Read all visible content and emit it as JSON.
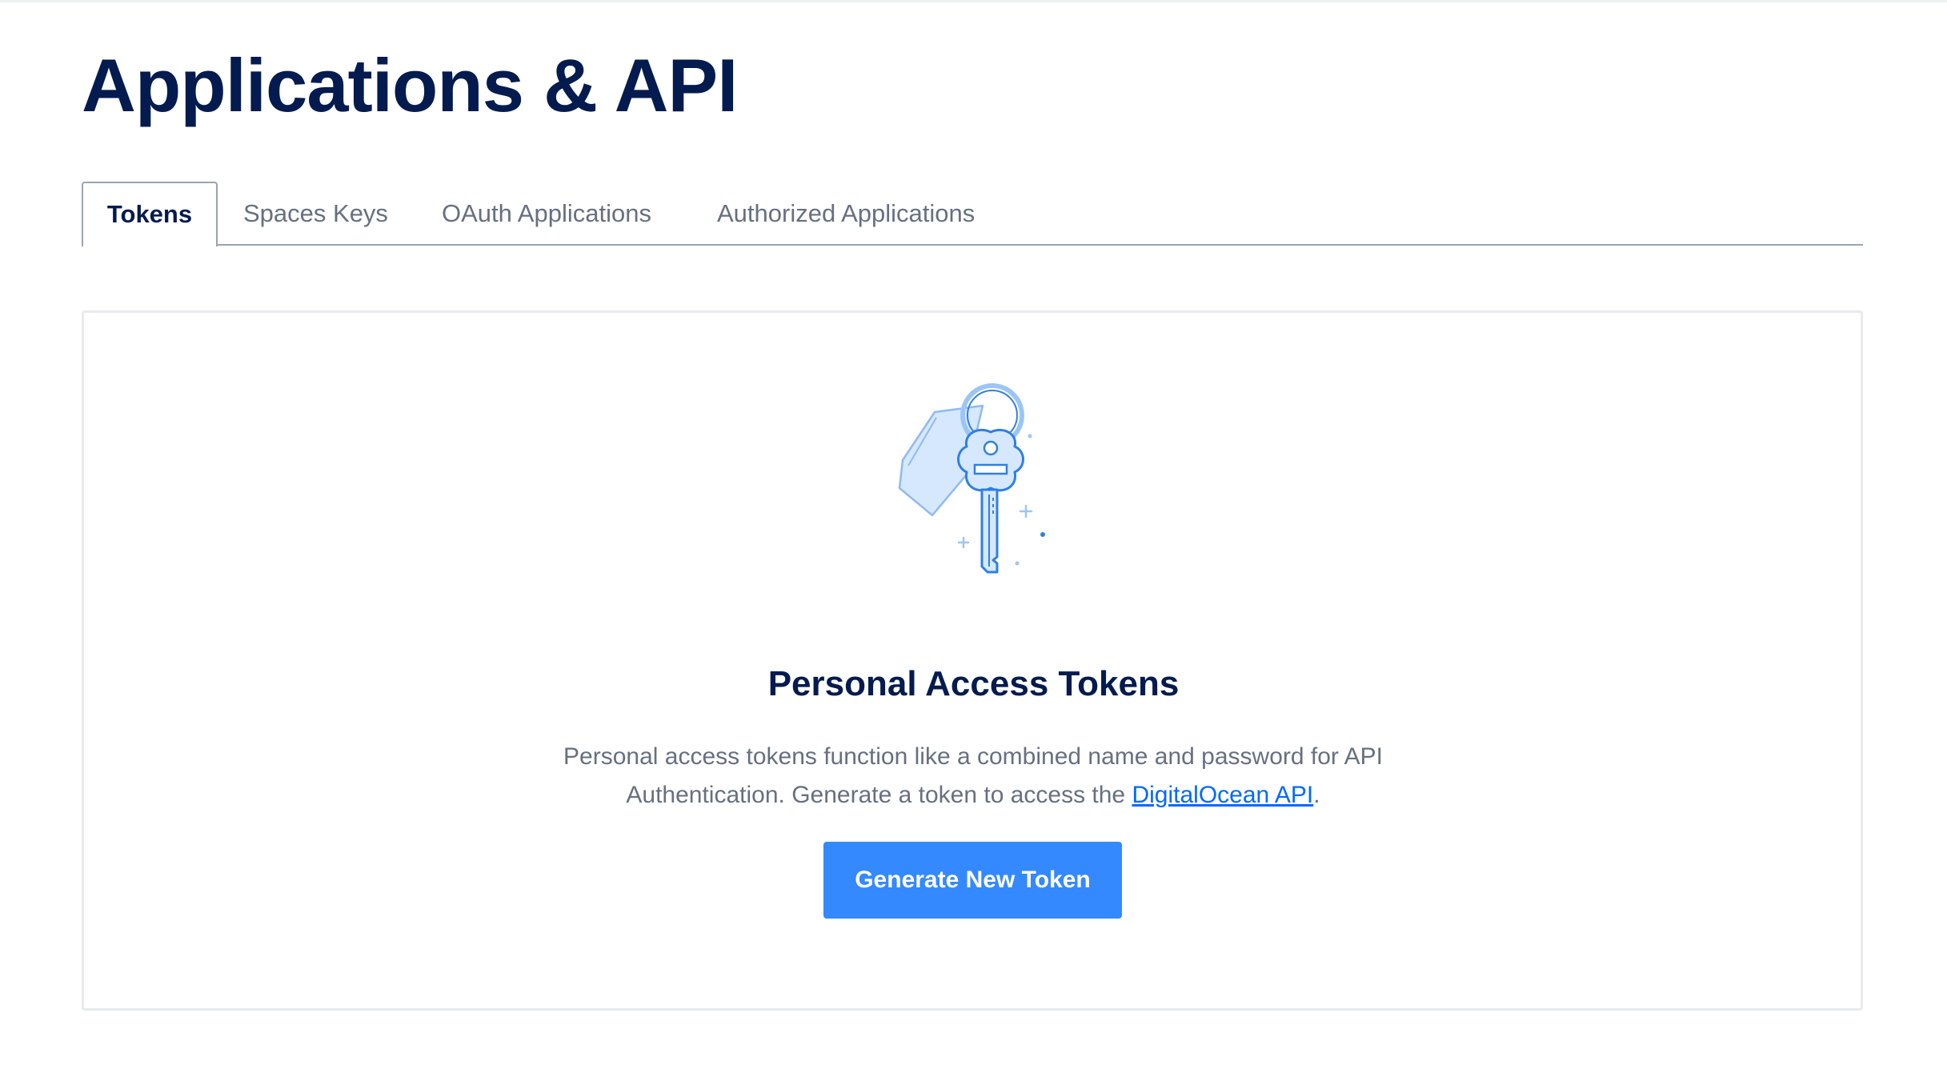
{
  "page": {
    "title": "Applications & API"
  },
  "tabs": [
    {
      "label": "Tokens",
      "active": true
    },
    {
      "label": "Spaces Keys",
      "active": false
    },
    {
      "label": "OAuth Applications",
      "active": false
    },
    {
      "label": "Authorized Applications",
      "active": false
    }
  ],
  "empty_state": {
    "illustration_icon": "key-with-tag-icon",
    "title": "Personal Access Tokens",
    "description_line1": "Personal access tokens function like a combined name and password for API",
    "description_line2_prefix": "Authentication. Generate a token to access the ",
    "link_label": "DigitalOcean API",
    "description_line2_suffix": ".",
    "button_label": "Generate New Token"
  },
  "colors": {
    "heading": "#031b4e",
    "muted_text": "#676f81",
    "link": "#0069ff",
    "primary_button": "#3489ff",
    "illustration_stroke": "#2f7fe5",
    "illustration_fill": "#d6e8fd"
  }
}
